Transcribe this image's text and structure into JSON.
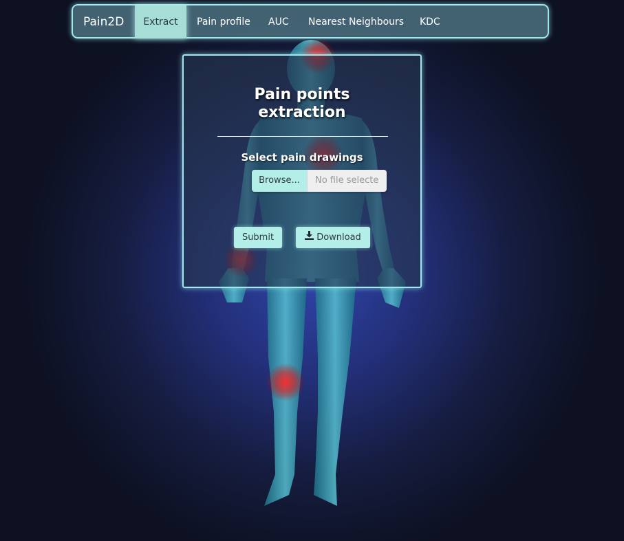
{
  "navbar": {
    "brand": "Pain2D",
    "items": [
      {
        "label": "Extract",
        "active": true
      },
      {
        "label": "Pain profile",
        "active": false
      },
      {
        "label": "AUC",
        "active": false
      },
      {
        "label": "Nearest Neighbours",
        "active": false
      },
      {
        "label": "KDC",
        "active": false
      }
    ]
  },
  "panel": {
    "title_line1": "Pain points",
    "title_line2": "extraction",
    "select_label": "Select pain drawings",
    "file_input": {
      "button_label": "Browse...",
      "status_text": "No file selecte"
    },
    "submit_label": "Submit",
    "download_label": "Download",
    "download_icon": "download-icon"
  },
  "colors": {
    "accent_border": "#9fe9ee",
    "button_bg": "#b4eee8",
    "pain_spot": "#ff2020"
  }
}
